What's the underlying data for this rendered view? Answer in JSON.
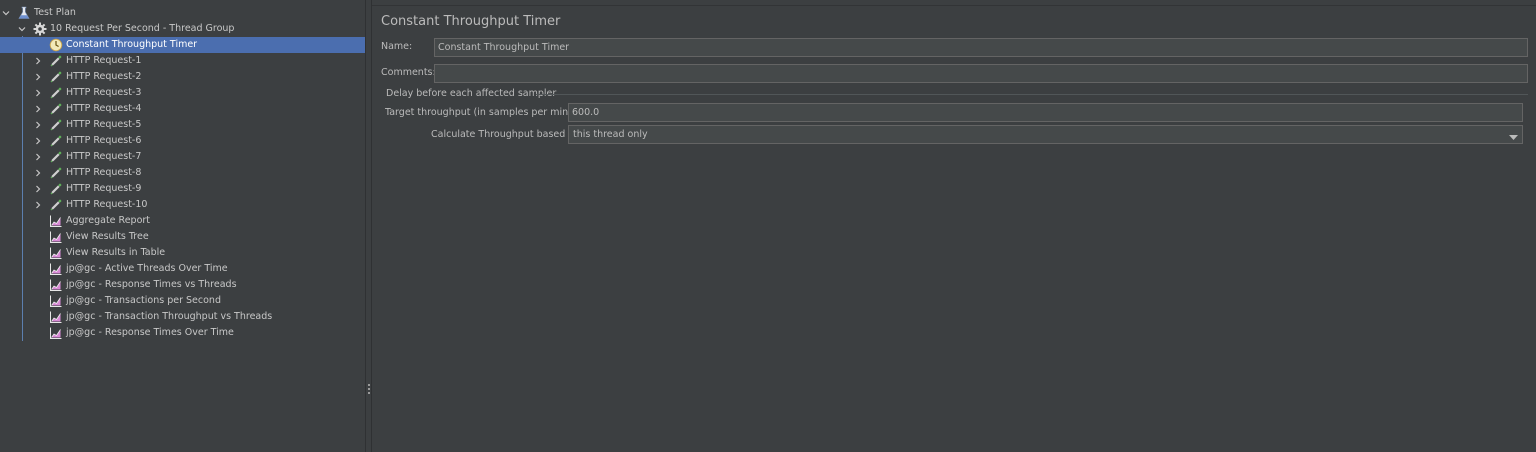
{
  "tree": {
    "items": [
      {
        "label": "Test Plan",
        "icon": "test-plan-icon",
        "expander": "down"
      },
      {
        "label": "10 Request Per Second - Thread Group",
        "icon": "gear-icon",
        "expander": "down"
      },
      {
        "label": "Constant Throughput Timer",
        "icon": "timer-icon",
        "expander": "none",
        "selected": true
      },
      {
        "label": "HTTP Request-1",
        "icon": "pipette-icon",
        "expander": "right"
      },
      {
        "label": "HTTP Request-2",
        "icon": "pipette-icon",
        "expander": "right"
      },
      {
        "label": "HTTP Request-3",
        "icon": "pipette-icon",
        "expander": "right"
      },
      {
        "label": "HTTP Request-4",
        "icon": "pipette-icon",
        "expander": "right"
      },
      {
        "label": "HTTP Request-5",
        "icon": "pipette-icon",
        "expander": "right"
      },
      {
        "label": "HTTP Request-6",
        "icon": "pipette-icon",
        "expander": "right"
      },
      {
        "label": "HTTP Request-7",
        "icon": "pipette-icon",
        "expander": "right"
      },
      {
        "label": "HTTP Request-8",
        "icon": "pipette-icon",
        "expander": "right"
      },
      {
        "label": "HTTP Request-9",
        "icon": "pipette-icon",
        "expander": "right"
      },
      {
        "label": "HTTP Request-10",
        "icon": "pipette-icon",
        "expander": "right"
      },
      {
        "label": "Aggregate Report",
        "icon": "listener-chart-icon",
        "expander": "none"
      },
      {
        "label": "View Results Tree",
        "icon": "listener-chart-icon",
        "expander": "none"
      },
      {
        "label": "View Results in Table",
        "icon": "listener-chart-icon",
        "expander": "none"
      },
      {
        "label": "jp@gc - Active Threads Over Time",
        "icon": "listener-chart-icon",
        "expander": "none"
      },
      {
        "label": "jp@gc - Response Times vs Threads",
        "icon": "listener-chart-icon",
        "expander": "none"
      },
      {
        "label": "jp@gc - Transactions per Second",
        "icon": "listener-chart-icon",
        "expander": "none"
      },
      {
        "label": "jp@gc - Transaction Throughput vs Threads",
        "icon": "listener-chart-icon",
        "expander": "none"
      },
      {
        "label": "jp@gc - Response Times Over Time",
        "icon": "listener-chart-icon",
        "expander": "none"
      }
    ]
  },
  "editor": {
    "title": "Constant Throughput Timer",
    "name_label": "Name:",
    "name_value": "Constant Throughput Timer",
    "comments_label": "Comments:",
    "comments_value": "",
    "group_title": "Delay before each affected sampler",
    "throughput_label": "Target throughput (in samples per minute):",
    "throughput_value": "600.0",
    "calc_label": "Calculate Throughput based on:",
    "calc_value": "this thread only"
  },
  "colors": {
    "background": "#3c3f41",
    "selection": "#4b6eaf",
    "field_background": "#45494a",
    "field_border": "#646464",
    "text": "#bbbbbb",
    "tree_guide": "#5c7fae"
  }
}
